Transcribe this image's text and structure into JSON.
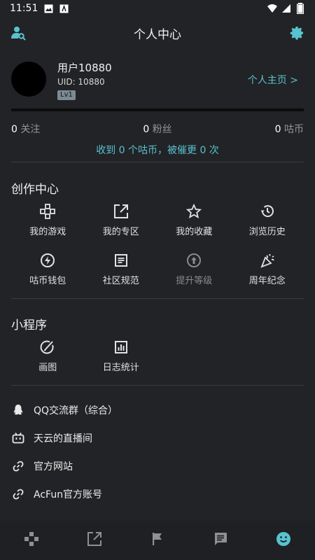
{
  "status_bar": {
    "time": "11:51",
    "icons_left": [
      "image-icon",
      "text-file-icon"
    ],
    "icons_right": [
      "wifi-icon",
      "signal-icon",
      "battery-icon"
    ]
  },
  "header": {
    "title": "个人中心",
    "left_icon": "user-search-icon",
    "right_icon": "gear-icon",
    "accent_color": "#58c3d0"
  },
  "profile": {
    "username": "用户10880",
    "uid": "UID: 10880",
    "level": "Lv1",
    "home_link": "个人主页 >"
  },
  "stats": [
    {
      "count": "0",
      "label": "关注"
    },
    {
      "count": "0",
      "label": "粉丝"
    },
    {
      "count": "0",
      "label": "咕币"
    }
  ],
  "coin_info": "收到 0 个咕币，被催更 0 次",
  "creation": {
    "title": "创作中心",
    "items": [
      {
        "label": "我的游戏",
        "icon": "gamepad-icon"
      },
      {
        "label": "我的专区",
        "icon": "external-link-icon"
      },
      {
        "label": "我的收藏",
        "icon": "star-icon"
      },
      {
        "label": "浏览历史",
        "icon": "history-icon"
      },
      {
        "label": "咕币钱包",
        "icon": "lightning-icon"
      },
      {
        "label": "社区规范",
        "icon": "document-icon"
      },
      {
        "label": "提升等级",
        "icon": "upload-circle-icon",
        "disabled": true
      },
      {
        "label": "周年纪念",
        "icon": "party-icon"
      }
    ]
  },
  "mini_programs": {
    "title": "小程序",
    "items": [
      {
        "label": "画图",
        "icon": "paint-icon"
      },
      {
        "label": "日志统计",
        "icon": "chart-icon"
      }
    ]
  },
  "links": [
    {
      "label": "QQ交流群（综合）",
      "icon": "qq-icon"
    },
    {
      "label": "天云的直播间",
      "icon": "bilibili-tv-icon"
    },
    {
      "label": "官方网站",
      "icon": "link-icon"
    },
    {
      "label": "AcFun官方账号",
      "icon": "link-icon"
    }
  ],
  "bottom_nav": [
    {
      "name": "games",
      "icon": "gamepad-icon"
    },
    {
      "name": "zone",
      "icon": "external-link-icon"
    },
    {
      "name": "flag",
      "icon": "flag-icon"
    },
    {
      "name": "messages",
      "icon": "message-icon"
    },
    {
      "name": "profile",
      "icon": "smile-icon",
      "active": true
    }
  ]
}
